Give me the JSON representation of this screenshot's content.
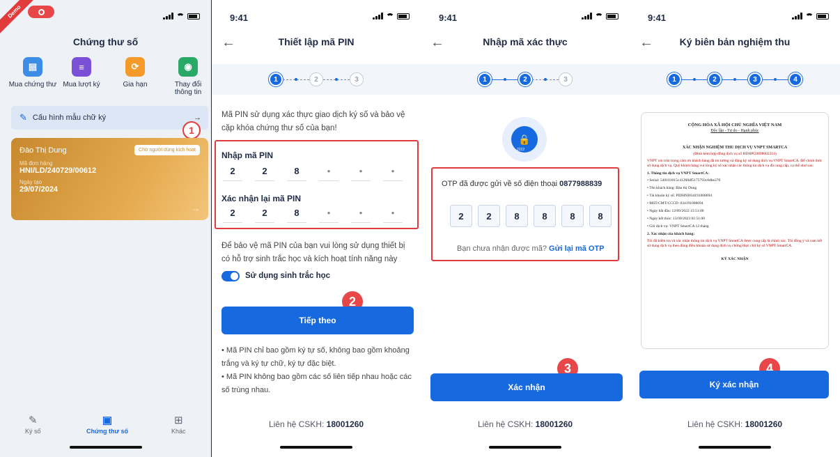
{
  "screen1": {
    "demo_ribbon": "Demo",
    "title": "Chứng thư số",
    "quick_actions": [
      {
        "label": "Mua chứng thư",
        "icon": "certificate-icon",
        "color": "#3d8de6"
      },
      {
        "label": "Mua lượt ký",
        "icon": "document-icon",
        "color": "#7b4fd6"
      },
      {
        "label": "Gia hạn",
        "icon": "renew-icon",
        "color": "#f39a2a"
      },
      {
        "label": "Thay đổi thông tin",
        "icon": "profile-icon",
        "color": "#2aa867"
      }
    ],
    "config_label": "Cấu hình mẫu chữ ký",
    "card": {
      "name": "Đào Thị Dung",
      "tag": "Chờ người dùng kích hoạt",
      "order_label": "Mã đơn hàng",
      "order_value": "HNI/LD/240729/00612",
      "date_label": "Ngày tạo",
      "date_value": "29/07/2024"
    },
    "nav": [
      {
        "label": "Ký số",
        "icon": "pen-icon"
      },
      {
        "label": "Chứng thư số",
        "icon": "certificate-icon"
      },
      {
        "label": "Khác",
        "icon": "grid-icon"
      }
    ],
    "badge": "1"
  },
  "screen2": {
    "time": "9:41",
    "title": "Thiết lập mã PIN",
    "steps": [
      "1",
      "2",
      "3"
    ],
    "intro": "Mã PIN sử dụng xác thực giao dịch ký số và bảo vệ cặp khóa chứng thư số của bạn!",
    "pin_label": "Nhập mã PIN",
    "pin_values": [
      "2",
      "2",
      "8",
      "•",
      "•",
      "•"
    ],
    "confirm_label": "Xác nhận lại mã PIN",
    "confirm_values": [
      "2",
      "2",
      "8",
      "•",
      "•",
      "•"
    ],
    "bio_text": "Để bảo vệ mã PIN của bạn vui lòng sử dụng thiết bị có hỗ trợ sinh trắc học và kích hoạt tính năng này",
    "bio_toggle_label": "Sử dụng sinh trắc học",
    "next_button": "Tiếp theo",
    "notes": [
      "Mã PIN chỉ bao gồm ký tự số, không bao gồm khoảng trắng và ký tự chữ, ký tự đặc biệt.",
      "Mã PIN không bao gồm các số liên tiếp nhau hoặc các số trùng nhau."
    ],
    "contact_label": "Liên hệ CSKH:",
    "contact_number": "18001260",
    "badge": "2"
  },
  "screen3": {
    "time": "9:41",
    "title": "Nhập mã xác thực",
    "steps": [
      "1",
      "2",
      "3"
    ],
    "lock_code": "2222",
    "otp_sent": "OTP đã được gửi về số điện thoại",
    "phone": "0877988839",
    "otp_values": [
      "2",
      "2",
      "8",
      "8",
      "8",
      "8"
    ],
    "not_received": "Bạn chưa nhận được mã?",
    "resend": "Gửi lại mã OTP",
    "confirm_button": "Xác nhận",
    "contact_label": "Liên hệ CSKH:",
    "contact_number": "18001260",
    "badge": "3"
  },
  "screen4": {
    "time": "9:41",
    "title": "Ký biên bản nghiệm thu",
    "steps": [
      "1",
      "2",
      "3",
      "4"
    ],
    "doc": {
      "nation": "CỘNG HÒA XÃ HỘI CHỦ NGHĨA VIỆT NAM",
      "motto": "Độc lập - Tự do - Hạnh phúc",
      "heading": "XÁC NHẬN NGHIỆM THU DỊCH VỤ VNPT SMARTCA",
      "subheading": "(Đính kèm hợp đồng dịch vụ số HDHPG0898002214)",
      "intro": "VNPT xin trân trọng cảm ơn khách hàng đã tin tưởng và đăng ký sử dụng dịch vụ VNPT SmartCA. Để chính thức sử dụng dịch vụ, Quý khách hàng vui lòng ký số xác nhận các thông tin dịch vụ đã cung cấp, cụ thể như sau:",
      "section1": "1. Thông tin dịch vụ VNPT SmartCA:",
      "items": [
        "• Serial: 540101015c41260df5175793c8dbe270",
        "• Tên khách hàng: Đào thị Dung",
        "• Tài khoản ký số: PIDHNI034191008694",
        "• MST/CMT/CCCD: 034191008694",
        "• Ngày bắt đầu: 12/09/2022 13:51:00",
        "• Ngày kết thúc: 13/09/2023 01:51:00",
        "• Gói dịch vụ: VNPT SmartCA 12 tháng"
      ],
      "section2": "2. Xác nhận của khách hàng:",
      "confirm_text": "Tôi đã kiểm tra và xác nhận thông tin dịch vụ VNPT SmartCA được cung cấp là chính xác. Tôi đồng ý và cam kết sử dụng dịch vụ theo đúng điều khoản sử dụng dịch vụ chứng thực chữ ký số VNPT SmartCA.",
      "sign_label": "KÝ XÁC NHẬN"
    },
    "sign_button": "Ký xác nhận",
    "contact_label": "Liên hệ CSKH:",
    "contact_number": "18001260",
    "badge": "4"
  },
  "colors": {
    "primary": "#1769e0",
    "highlight": "#e03c3c"
  }
}
